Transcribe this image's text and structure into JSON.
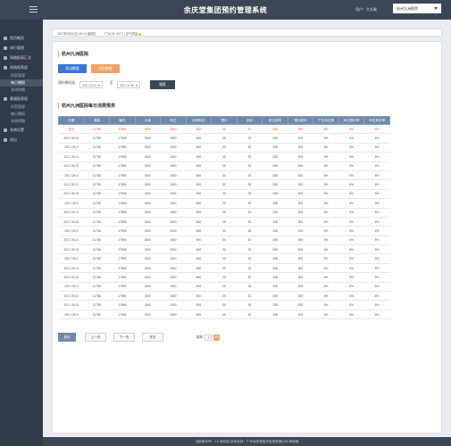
{
  "header": {
    "title": "余庆堂集团预约管理系统",
    "user": "用户：大头象",
    "hospital_select": "杭州九洲医院"
  },
  "sidebar": {
    "items": [
      {
        "label": "首页概览",
        "icon": "home-icon"
      },
      {
        "label": "排行管理",
        "icon": "list-icon"
      },
      {
        "label": "网络报表汇总",
        "icon": "report-icon"
      },
      {
        "label": "网络报表组",
        "icon": "chart-icon"
      },
      {
        "label": "客服报表组",
        "icon": "headset-icon"
      },
      {
        "label": "系统设置",
        "icon": "wrench-icon"
      },
      {
        "label": "退出",
        "icon": "logout-icon"
      }
    ],
    "sub_network": [
      "科室管理",
      "每日播报",
      "咨询明细"
    ],
    "sub_service": [
      "科室管理",
      "每日播报",
      "咨询明细"
    ]
  },
  "infobar": {
    "date": "2017年5月12日 09:12 星期五",
    "weather": "广州 24~31°C | 空气质量"
  },
  "panel": {
    "section1_title": "杭州九洲医院",
    "btn_export": "导出数据",
    "btn_other": "对比数据",
    "filter_label": "预约期间选",
    "date_from": "2017-5-01",
    "to_label": "至",
    "date_to": "2017-5-08",
    "query_btn": "搜索",
    "section2_title": "杭州九洲医院每日消费报表"
  },
  "table": {
    "headers": [
      "日期",
      "消费",
      "曝光",
      "点量",
      "科达",
      "检测科达",
      "预约",
      "到诊",
      "科达成本",
      "预约成本",
      "产生科达率",
      "科达预约率",
      "科达到诊率"
    ],
    "total": [
      "总计",
      "11758",
      "17896",
      "1500",
      "1500",
      "800",
      "30",
      "20",
      "258",
      "500",
      "6%",
      "6%",
      "6%"
    ],
    "rows": [
      [
        "2017-05-10",
        "11758",
        "17896",
        "1500",
        "1500",
        "800",
        "30",
        "30",
        "258",
        "500",
        "6%",
        "6%",
        "6%"
      ],
      [
        "2017-05-9",
        "11758",
        "17896",
        "1500",
        "1500",
        "800",
        "30",
        "30",
        "258",
        "500",
        "6%",
        "6%",
        "6%"
      ],
      [
        "2017-05-11",
        "11758",
        "17896",
        "1500",
        "1500",
        "800",
        "30",
        "30",
        "258",
        "500",
        "6%",
        "6%",
        "6%"
      ],
      [
        "2017-05-10",
        "11758",
        "17896",
        "1500",
        "1500",
        "800",
        "30",
        "30",
        "258",
        "500",
        "6%",
        "6%",
        "6%"
      ],
      [
        "2017-05-9",
        "11758",
        "17896",
        "1500",
        "1500",
        "800",
        "30",
        "30",
        "258",
        "500",
        "6%",
        "6%",
        "6%"
      ],
      [
        "2017-05-11",
        "11758",
        "17896",
        "1500",
        "1500",
        "800",
        "30",
        "30",
        "258",
        "500",
        "6%",
        "6%",
        "6%"
      ],
      [
        "2017-05-10",
        "11758",
        "17896",
        "1500",
        "1500",
        "800",
        "30",
        "30",
        "258",
        "500",
        "6%",
        "6%",
        "6%"
      ],
      [
        "2017-05-9",
        "11758",
        "17896",
        "1500",
        "1500",
        "800",
        "30",
        "30",
        "258",
        "500",
        "6%",
        "6%",
        "6%"
      ],
      [
        "2017-05-11",
        "11758",
        "17896",
        "1500",
        "1500",
        "800",
        "30",
        "30",
        "258",
        "500",
        "6%",
        "6%",
        "6%"
      ],
      [
        "2017-05-10",
        "11758",
        "17896",
        "1500",
        "1500",
        "800",
        "30",
        "30",
        "258",
        "500",
        "6%",
        "6%",
        "6%"
      ],
      [
        "2017-05-9",
        "11758",
        "17896",
        "1500",
        "1500",
        "800",
        "30",
        "30",
        "258",
        "500",
        "6%",
        "6%",
        "6%"
      ],
      [
        "2017-05-11",
        "11758",
        "17896",
        "1500",
        "1500",
        "800",
        "30",
        "30",
        "258",
        "500",
        "6%",
        "6%",
        "6%"
      ],
      [
        "2017-05-10",
        "11758",
        "17896",
        "1500",
        "1500",
        "800",
        "30",
        "30",
        "258",
        "500",
        "6%",
        "6%",
        "6%"
      ],
      [
        "2017-05-9",
        "11758",
        "17896",
        "1500",
        "1500",
        "800",
        "30",
        "30",
        "258",
        "500",
        "6%",
        "6%",
        "6%"
      ],
      [
        "2017-05-11",
        "11758",
        "17896",
        "1500",
        "1500",
        "800",
        "30",
        "30",
        "258",
        "500",
        "6%",
        "6%",
        "6%"
      ],
      [
        "2017-05-10",
        "11758",
        "17896",
        "1500",
        "1500",
        "800",
        "30",
        "30",
        "258",
        "500",
        "6%",
        "6%",
        "6%"
      ],
      [
        "2017-05-4",
        "11758",
        "17896",
        "1500",
        "1500",
        "800",
        "30",
        "30",
        "258",
        "500",
        "6%",
        "6%",
        "6%"
      ],
      [
        "2017-05-11",
        "11758",
        "17896",
        "1500",
        "1500",
        "800",
        "30",
        "30",
        "258",
        "500",
        "6%",
        "6%",
        "6%"
      ],
      [
        "2017-05-10",
        "11758",
        "17896",
        "1500",
        "1500",
        "800",
        "30",
        "30",
        "258",
        "500",
        "6%",
        "6%",
        "6%"
      ],
      [
        "2017-05-9",
        "11758",
        "17896",
        "1500",
        "1500",
        "800",
        "30",
        "30",
        "258",
        "500",
        "6%",
        "6%",
        "6%"
      ]
    ]
  },
  "pager": {
    "first": "首页",
    "prev": "上一页",
    "next": "下一页",
    "last": "末页",
    "jump_label": "跳转",
    "page_value": "2",
    "go": "GO"
  },
  "footer": {
    "text": "当前版本号：1.0 测试版    技术支持：广州余庆堂医疗投资有限公司 网络部"
  },
  "colors": {
    "topbar": "#3c4656",
    "sidebar": "#313a48",
    "table_header": "#6f8aa8",
    "accent_orange": "#f0a36a",
    "accent_blue": "#3c76d1",
    "total_row": "#e04a2b"
  }
}
